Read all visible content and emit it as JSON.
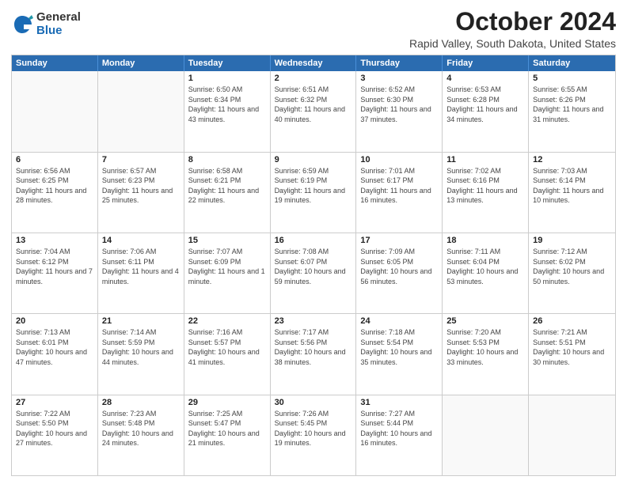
{
  "logo": {
    "general": "General",
    "blue": "Blue"
  },
  "title": "October 2024",
  "subtitle": "Rapid Valley, South Dakota, United States",
  "days": [
    "Sunday",
    "Monday",
    "Tuesday",
    "Wednesday",
    "Thursday",
    "Friday",
    "Saturday"
  ],
  "weeks": [
    [
      {
        "day": "",
        "empty": true
      },
      {
        "day": "",
        "empty": true
      },
      {
        "day": "1",
        "sunrise": "6:50 AM",
        "sunset": "6:34 PM",
        "daylight": "11 hours and 43 minutes."
      },
      {
        "day": "2",
        "sunrise": "6:51 AM",
        "sunset": "6:32 PM",
        "daylight": "11 hours and 40 minutes."
      },
      {
        "day": "3",
        "sunrise": "6:52 AM",
        "sunset": "6:30 PM",
        "daylight": "11 hours and 37 minutes."
      },
      {
        "day": "4",
        "sunrise": "6:53 AM",
        "sunset": "6:28 PM",
        "daylight": "11 hours and 34 minutes."
      },
      {
        "day": "5",
        "sunrise": "6:55 AM",
        "sunset": "6:26 PM",
        "daylight": "11 hours and 31 minutes."
      }
    ],
    [
      {
        "day": "6",
        "sunrise": "6:56 AM",
        "sunset": "6:25 PM",
        "daylight": "11 hours and 28 minutes."
      },
      {
        "day": "7",
        "sunrise": "6:57 AM",
        "sunset": "6:23 PM",
        "daylight": "11 hours and 25 minutes."
      },
      {
        "day": "8",
        "sunrise": "6:58 AM",
        "sunset": "6:21 PM",
        "daylight": "11 hours and 22 minutes."
      },
      {
        "day": "9",
        "sunrise": "6:59 AM",
        "sunset": "6:19 PM",
        "daylight": "11 hours and 19 minutes."
      },
      {
        "day": "10",
        "sunrise": "7:01 AM",
        "sunset": "6:17 PM",
        "daylight": "11 hours and 16 minutes."
      },
      {
        "day": "11",
        "sunrise": "7:02 AM",
        "sunset": "6:16 PM",
        "daylight": "11 hours and 13 minutes."
      },
      {
        "day": "12",
        "sunrise": "7:03 AM",
        "sunset": "6:14 PM",
        "daylight": "11 hours and 10 minutes."
      }
    ],
    [
      {
        "day": "13",
        "sunrise": "7:04 AM",
        "sunset": "6:12 PM",
        "daylight": "11 hours and 7 minutes."
      },
      {
        "day": "14",
        "sunrise": "7:06 AM",
        "sunset": "6:11 PM",
        "daylight": "11 hours and 4 minutes."
      },
      {
        "day": "15",
        "sunrise": "7:07 AM",
        "sunset": "6:09 PM",
        "daylight": "11 hours and 1 minute."
      },
      {
        "day": "16",
        "sunrise": "7:08 AM",
        "sunset": "6:07 PM",
        "daylight": "10 hours and 59 minutes."
      },
      {
        "day": "17",
        "sunrise": "7:09 AM",
        "sunset": "6:05 PM",
        "daylight": "10 hours and 56 minutes."
      },
      {
        "day": "18",
        "sunrise": "7:11 AM",
        "sunset": "6:04 PM",
        "daylight": "10 hours and 53 minutes."
      },
      {
        "day": "19",
        "sunrise": "7:12 AM",
        "sunset": "6:02 PM",
        "daylight": "10 hours and 50 minutes."
      }
    ],
    [
      {
        "day": "20",
        "sunrise": "7:13 AM",
        "sunset": "6:01 PM",
        "daylight": "10 hours and 47 minutes."
      },
      {
        "day": "21",
        "sunrise": "7:14 AM",
        "sunset": "5:59 PM",
        "daylight": "10 hours and 44 minutes."
      },
      {
        "day": "22",
        "sunrise": "7:16 AM",
        "sunset": "5:57 PM",
        "daylight": "10 hours and 41 minutes."
      },
      {
        "day": "23",
        "sunrise": "7:17 AM",
        "sunset": "5:56 PM",
        "daylight": "10 hours and 38 minutes."
      },
      {
        "day": "24",
        "sunrise": "7:18 AM",
        "sunset": "5:54 PM",
        "daylight": "10 hours and 35 minutes."
      },
      {
        "day": "25",
        "sunrise": "7:20 AM",
        "sunset": "5:53 PM",
        "daylight": "10 hours and 33 minutes."
      },
      {
        "day": "26",
        "sunrise": "7:21 AM",
        "sunset": "5:51 PM",
        "daylight": "10 hours and 30 minutes."
      }
    ],
    [
      {
        "day": "27",
        "sunrise": "7:22 AM",
        "sunset": "5:50 PM",
        "daylight": "10 hours and 27 minutes."
      },
      {
        "day": "28",
        "sunrise": "7:23 AM",
        "sunset": "5:48 PM",
        "daylight": "10 hours and 24 minutes."
      },
      {
        "day": "29",
        "sunrise": "7:25 AM",
        "sunset": "5:47 PM",
        "daylight": "10 hours and 21 minutes."
      },
      {
        "day": "30",
        "sunrise": "7:26 AM",
        "sunset": "5:45 PM",
        "daylight": "10 hours and 19 minutes."
      },
      {
        "day": "31",
        "sunrise": "7:27 AM",
        "sunset": "5:44 PM",
        "daylight": "10 hours and 16 minutes."
      },
      {
        "day": "",
        "empty": true
      },
      {
        "day": "",
        "empty": true
      }
    ]
  ]
}
